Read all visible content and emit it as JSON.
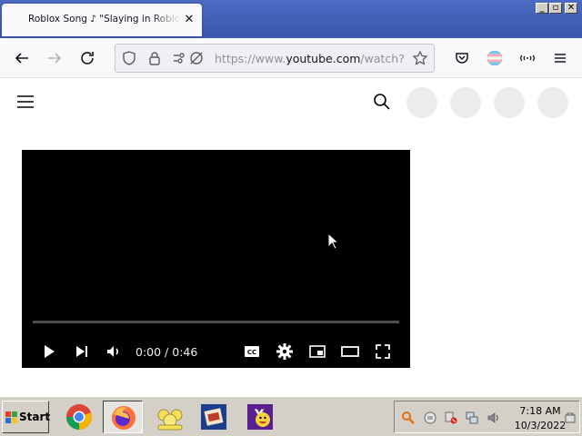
{
  "browser": {
    "tab": {
      "title": "Roblox Song ♪ \"Slaying in Roblox R",
      "close_glyph": "✕"
    },
    "window_controls": {
      "minimize": "_",
      "maximize": "▫",
      "close": "✕"
    },
    "url": {
      "scheme_and_sub": "https://www.",
      "host": "youtube.com",
      "path": "/watch?v="
    },
    "icons": {
      "back": "arrow-left-icon",
      "forward": "arrow-right-icon",
      "reload": "reload-icon",
      "shield": "shield-icon",
      "lock": "lock-icon",
      "permissions": "permissions-icon",
      "bookmark": "star-icon",
      "pocket": "pocket-icon",
      "account": "account-icon",
      "extensions": "extensions-icon",
      "menu": "hamburger-menu-icon"
    }
  },
  "youtube": {
    "icons": {
      "menu": "hamburger-menu-icon",
      "search": "search-icon"
    },
    "header_placeholders": 4
  },
  "player": {
    "current_time": "0:00",
    "duration": "0:46",
    "time_separator": " / ",
    "progress_fraction": 0,
    "colors": {
      "background": "#000000",
      "progress": "#ff0000"
    },
    "controls": [
      "play-icon",
      "next-icon",
      "volume-icon",
      "captions-icon",
      "settings-icon",
      "miniplayer-icon",
      "theater-mode-icon",
      "fullscreen-icon"
    ]
  },
  "taskbar": {
    "start_label": "Start",
    "apps": [
      "chrome-icon",
      "firefox-icon",
      "family-icon",
      "photo-app-icon",
      "yahoo-messenger-icon"
    ],
    "tray_icons": [
      "search-icon",
      "sync-icon",
      "network-blocked-icon",
      "network-icon",
      "volume-icon",
      "safely-remove-icon"
    ],
    "clock": {
      "time": "7:18 AM",
      "date": "10/3/2022"
    }
  }
}
